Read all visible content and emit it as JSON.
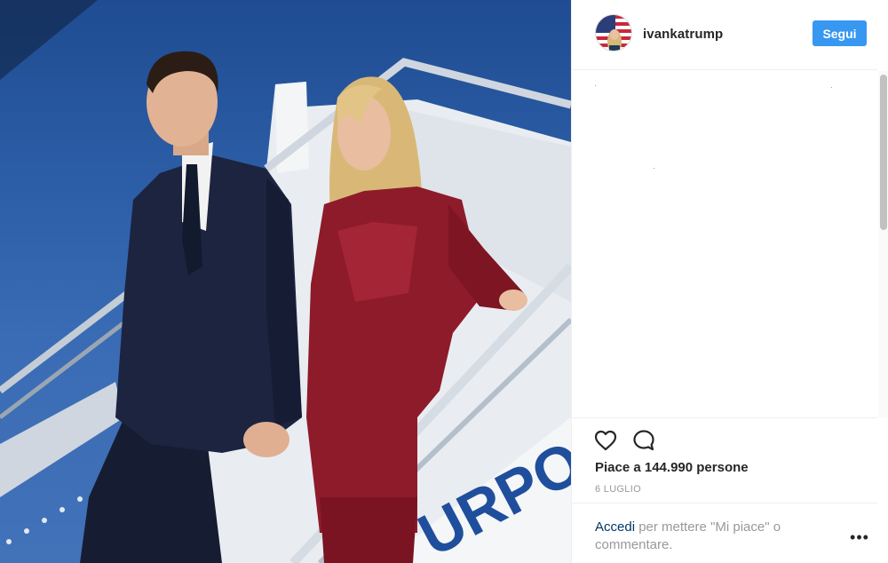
{
  "post": {
    "username": "ivankatrump",
    "follow_label": "Segui",
    "likes_text": "Piace a 144.990 persone",
    "date": "6 LUGLIO",
    "login_link": "Accedi",
    "login_rest": " per mettere \"Mi piace\" o commentare.",
    "more_label": "•••"
  },
  "icons": {
    "like": "heart-outline-icon",
    "comment": "speech-bubble-icon",
    "more": "more-options-icon"
  },
  "colors": {
    "follow_button": "#3897f0",
    "link": "#003569",
    "suit": "#1c2440",
    "dress": "#8e1b2a",
    "sky": "#2d5fa8"
  }
}
